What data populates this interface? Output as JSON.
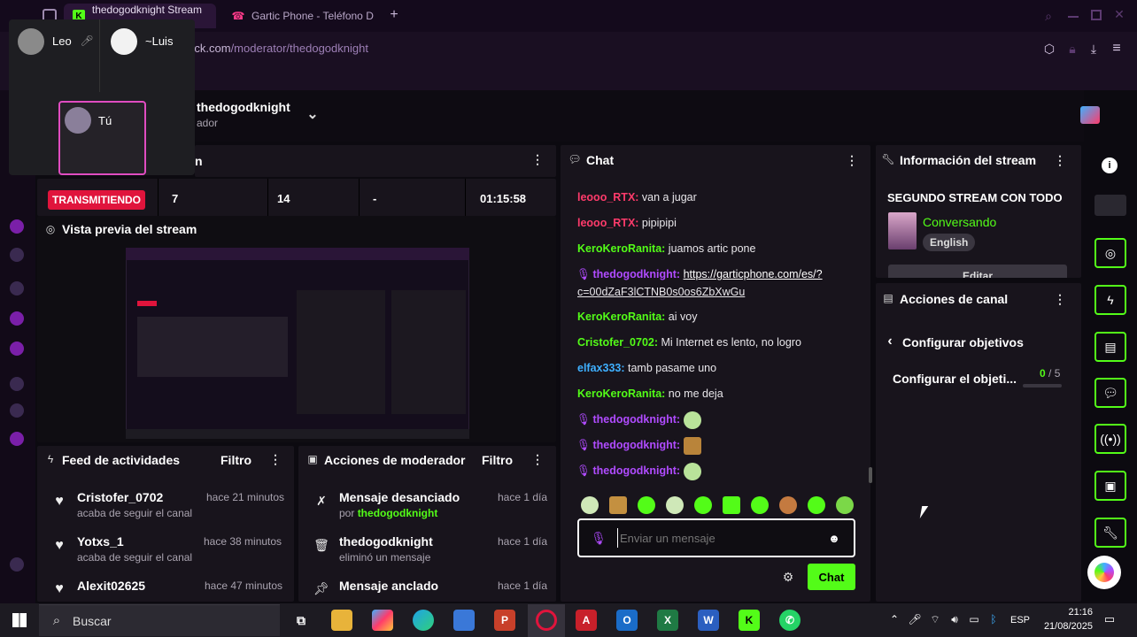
{
  "browser": {
    "tabs": [
      {
        "label": "thedogodknight Stream -"
      },
      {
        "label": "Gartic Phone - Teléfono D"
      }
    ],
    "add_tab": "+",
    "url_host": "kick.com",
    "url_path": "/moderator/thedogodknight"
  },
  "call_overlay": {
    "participants": [
      {
        "name": "Leo"
      },
      {
        "name": "~Luis"
      },
      {
        "name": "Tú"
      }
    ]
  },
  "header": {
    "channel_name": "thedogodknight",
    "role": "ador"
  },
  "stats_panel": {
    "title_fragment": "n",
    "status_badge": "TRANSMITIENDO",
    "values": [
      "7",
      "14",
      "-",
      "01:15:58"
    ]
  },
  "preview_panel": {
    "title": "Vista previa del stream"
  },
  "feed_panel": {
    "title": "Feed de actividades",
    "filter_label": "Filtro",
    "items": [
      {
        "user": "Cristofer_0702",
        "time": "hace 21 minutos",
        "action": "acaba de seguir el canal"
      },
      {
        "user": "Yotxs_1",
        "time": "hace 38 minutos",
        "action": "acaba de seguir el canal"
      },
      {
        "user": "Alexit02625",
        "time": "hace 47 minutos",
        "action": ""
      }
    ]
  },
  "mod_panel": {
    "title": "Acciones de moderador",
    "filter_label": "Filtro",
    "items": [
      {
        "action": "Mensaje desanciado",
        "by_prefix": "por ",
        "by_user": "thedogodknight",
        "time": "hace 1 día"
      },
      {
        "action": "thedogodknight",
        "detail": "eliminó un mensaje",
        "time": "hace 1 día"
      },
      {
        "action": "Mensaje anclado",
        "time": "hace 1 día"
      }
    ]
  },
  "chat_panel": {
    "title": "Chat",
    "messages": [
      {
        "user": "leooo_RTX:",
        "text": " van a jugar"
      },
      {
        "user": "leooo_RTX:",
        "text": " pipipipi"
      },
      {
        "user": "KeroKeroRanita:",
        "text": " juamos artic pone"
      },
      {
        "user": "thedogodknight:",
        "link_line1": "https://garticphone.com/es/?",
        "link_line2": "c=00dZaF3lCTNB0s0os6ZbXwGu"
      },
      {
        "user": "KeroKeroRanita:",
        "text": " ai voy"
      },
      {
        "user": "Cristofer_0702:",
        "text": " Mi Internet es lento, no logro"
      },
      {
        "user": "elfax333:",
        "text": " tamb pasame uno"
      },
      {
        "user": "KeroKeroRanita:",
        "text": " no me deja"
      },
      {
        "user": "thedogodknight:",
        "text": ""
      },
      {
        "user": "thedogodknight:",
        "text": ""
      },
      {
        "user": "thedogodknight:",
        "text": ""
      }
    ],
    "input_placeholder": "Enviar un mensaje",
    "send_label": "Chat"
  },
  "stream_info_panel": {
    "title": "Información del stream",
    "stream_title": "SEGUNDO STREAM CON TODO",
    "category": "Conversando",
    "language": "English",
    "edit_label": "Editar"
  },
  "channel_actions_panel": {
    "title": "Acciones de canal",
    "back_label": "Configurar objetivos",
    "goal_label": "Configurar el objeti...",
    "goal_current": "0",
    "goal_total": " / 5"
  },
  "taskbar": {
    "search_placeholder": "Buscar",
    "language": "ESP",
    "time": "21:16",
    "date": "21/08/2025"
  },
  "colors": {
    "kick_green": "#53fc18",
    "live_red": "#e0143c",
    "mod_purple": "#b04bff",
    "panel_bg": "#18141c"
  }
}
